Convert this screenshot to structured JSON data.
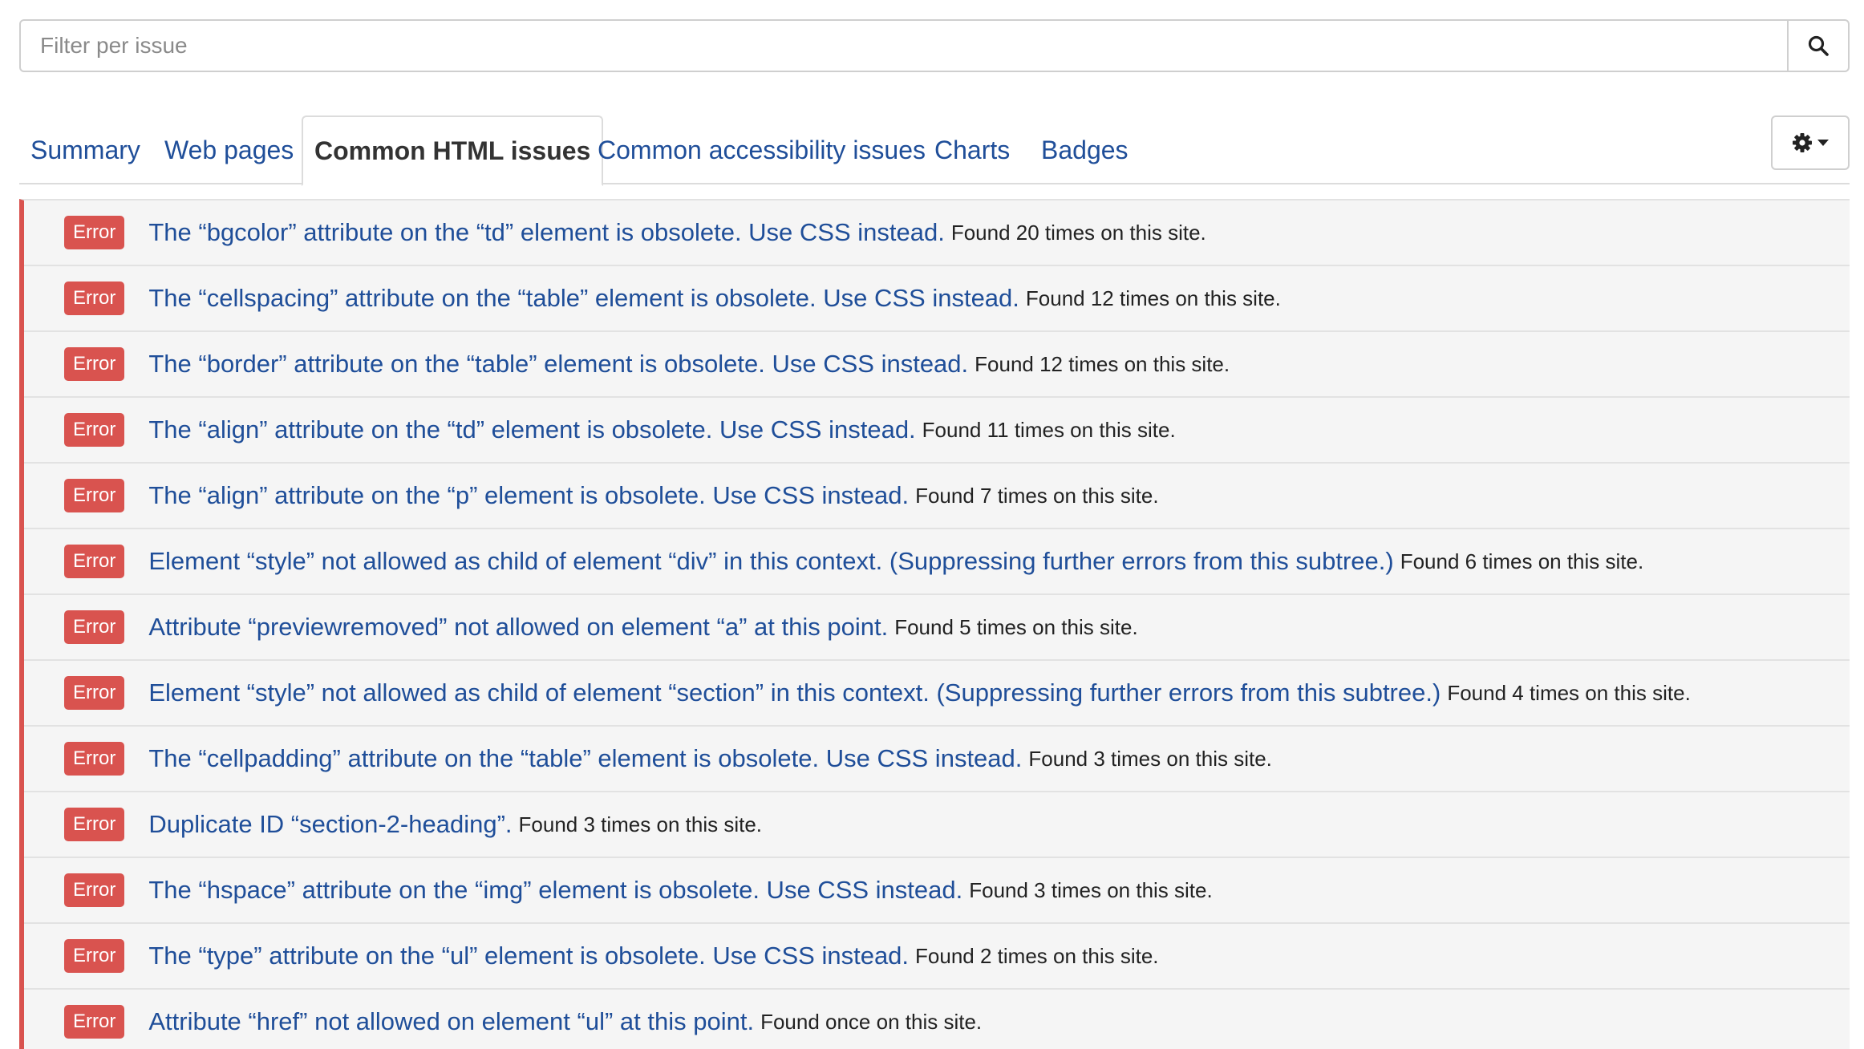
{
  "search": {
    "placeholder": "Filter per issue",
    "value": ""
  },
  "tabs": [
    {
      "label": "Summary"
    },
    {
      "label": "Web pages"
    },
    {
      "label": "Common HTML issues"
    },
    {
      "label": "Common accessibility issues"
    },
    {
      "label": "Charts"
    },
    {
      "label": "Badges"
    }
  ],
  "active_tab": "Common HTML issues",
  "colors": {
    "link": "#1f4e99",
    "error": "#d9534f"
  },
  "icons": {
    "search": "search-icon",
    "settings": "gear-icon"
  },
  "issues": [
    {
      "badge": "Error",
      "text": "The “bgcolor” attribute on the “td” element is obsolete. Use CSS instead.",
      "found": "Found 20 times on this site."
    },
    {
      "badge": "Error",
      "text": "The “cellspacing” attribute on the “table” element is obsolete. Use CSS instead.",
      "found": "Found 12 times on this site."
    },
    {
      "badge": "Error",
      "text": "The “border” attribute on the “table” element is obsolete. Use CSS instead.",
      "found": "Found 12 times on this site."
    },
    {
      "badge": "Error",
      "text": "The “align” attribute on the “td” element is obsolete. Use CSS instead.",
      "found": "Found 11 times on this site."
    },
    {
      "badge": "Error",
      "text": "The “align” attribute on the “p” element is obsolete. Use CSS instead.",
      "found": "Found 7 times on this site."
    },
    {
      "badge": "Error",
      "text": "Element “style” not allowed as child of element “div” in this context. (Suppressing further errors from this subtree.)",
      "found": "Found 6 times on this site."
    },
    {
      "badge": "Error",
      "text": "Attribute “previewremoved” not allowed on element “a” at this point.",
      "found": "Found 5 times on this site."
    },
    {
      "badge": "Error",
      "text": "Element “style” not allowed as child of element “section” in this context. (Suppressing further errors from this subtree.)",
      "found": "Found 4 times on this site."
    },
    {
      "badge": "Error",
      "text": "The “cellpadding” attribute on the “table” element is obsolete. Use CSS instead.",
      "found": "Found 3 times on this site."
    },
    {
      "badge": "Error",
      "text": "Duplicate ID “section-2-heading”.",
      "found": "Found 3 times on this site."
    },
    {
      "badge": "Error",
      "text": "The “hspace” attribute on the “img” element is obsolete. Use CSS instead.",
      "found": "Found 3 times on this site."
    },
    {
      "badge": "Error",
      "text": "The “type” attribute on the “ul” element is obsolete. Use CSS instead.",
      "found": "Found 2 times on this site."
    },
    {
      "badge": "Error",
      "text": "Attribute “href” not allowed on element “ul” at this point.",
      "found": "Found once on this site."
    }
  ]
}
